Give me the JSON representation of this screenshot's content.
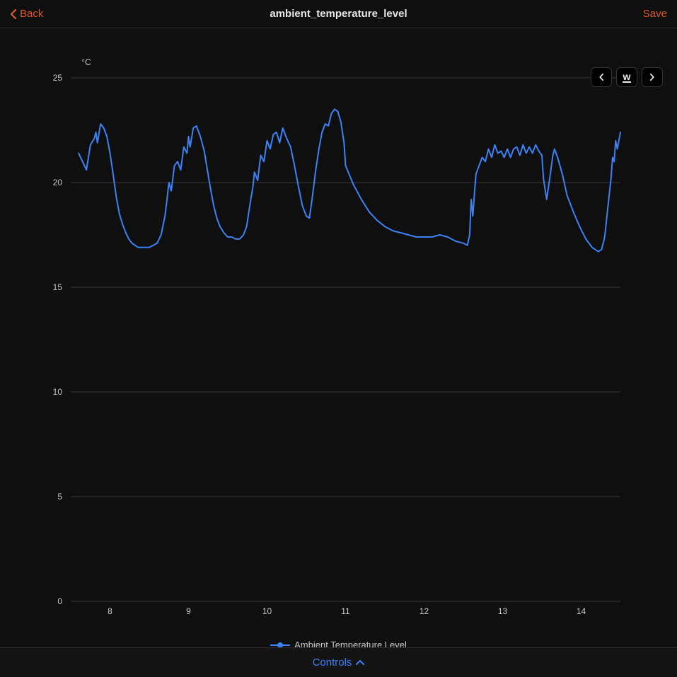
{
  "header": {
    "back_label": "Back",
    "title": "ambient_temperature_level",
    "save_label": "Save"
  },
  "range": {
    "period_label": "w"
  },
  "legend": {
    "series_label": "Ambient Temperature Level"
  },
  "footer": {
    "controls_label": "Controls"
  },
  "colors": {
    "accent": "#e05a1f",
    "series": "#3b82f6",
    "grid": "#3a3a3a",
    "bg": "#0f0f0f"
  },
  "chart_data": {
    "type": "line",
    "title": "ambient_temperature_level",
    "xlabel": "",
    "ylabel": "",
    "unit": "°C",
    "ylim": [
      0,
      25
    ],
    "yticks": [
      0,
      5,
      10,
      15,
      20,
      25
    ],
    "xlim": [
      7.5,
      14.5
    ],
    "xticks": [
      8,
      9,
      10,
      11,
      12,
      13,
      14
    ],
    "legend_position": "bottom",
    "grid": true,
    "series": [
      {
        "name": "Ambient Temperature Level",
        "x": [
          7.6,
          7.65,
          7.7,
          7.75,
          7.8,
          7.82,
          7.84,
          7.88,
          7.92,
          7.96,
          8.0,
          8.04,
          8.08,
          8.12,
          8.16,
          8.2,
          8.24,
          8.28,
          8.32,
          8.36,
          8.4,
          8.45,
          8.5,
          8.55,
          8.6,
          8.65,
          8.7,
          8.72,
          8.75,
          8.78,
          8.82,
          8.86,
          8.9,
          8.94,
          8.98,
          9.0,
          9.02,
          9.06,
          9.1,
          9.15,
          9.2,
          9.24,
          9.28,
          9.32,
          9.36,
          9.4,
          9.45,
          9.5,
          9.55,
          9.6,
          9.65,
          9.7,
          9.74,
          9.78,
          9.82,
          9.84,
          9.88,
          9.92,
          9.96,
          10.0,
          10.04,
          10.08,
          10.12,
          10.16,
          10.2,
          10.25,
          10.3,
          10.35,
          10.4,
          10.45,
          10.5,
          10.54,
          10.58,
          10.62,
          10.66,
          10.7,
          10.74,
          10.78,
          10.82,
          10.86,
          10.9,
          10.94,
          10.98,
          11.0,
          11.1,
          11.2,
          11.3,
          11.4,
          11.5,
          11.6,
          11.7,
          11.8,
          11.9,
          12.0,
          12.1,
          12.2,
          12.3,
          12.4,
          12.5,
          12.55,
          12.58,
          12.6,
          12.62,
          12.66,
          12.7,
          12.74,
          12.78,
          12.82,
          12.86,
          12.9,
          12.94,
          12.98,
          13.02,
          13.06,
          13.1,
          13.14,
          13.18,
          13.22,
          13.26,
          13.3,
          13.34,
          13.38,
          13.42,
          13.46,
          13.5,
          13.52,
          13.56,
          13.6,
          13.64,
          13.66,
          13.7,
          13.76,
          13.82,
          13.9,
          13.98,
          14.06,
          14.14,
          14.22,
          14.26,
          14.3,
          14.34,
          14.38,
          14.4,
          14.42,
          14.44,
          14.46,
          14.5
        ],
        "values": [
          21.4,
          21.0,
          20.6,
          21.8,
          22.1,
          22.4,
          21.9,
          22.8,
          22.6,
          22.2,
          21.4,
          20.4,
          19.3,
          18.5,
          18.0,
          17.6,
          17.3,
          17.1,
          17.0,
          16.9,
          16.9,
          16.9,
          16.9,
          17.0,
          17.1,
          17.5,
          18.4,
          19.0,
          20.0,
          19.6,
          20.8,
          21.0,
          20.6,
          21.7,
          21.4,
          22.2,
          21.7,
          22.6,
          22.7,
          22.2,
          21.5,
          20.6,
          19.7,
          18.9,
          18.3,
          17.9,
          17.6,
          17.4,
          17.4,
          17.3,
          17.3,
          17.5,
          17.9,
          18.9,
          19.8,
          20.5,
          20.1,
          21.3,
          21.0,
          22.0,
          21.6,
          22.3,
          22.4,
          21.9,
          22.6,
          22.1,
          21.7,
          20.8,
          19.8,
          18.9,
          18.4,
          18.3,
          19.4,
          20.6,
          21.6,
          22.4,
          22.8,
          22.7,
          23.3,
          23.5,
          23.4,
          22.9,
          21.9,
          20.8,
          19.9,
          19.2,
          18.6,
          18.2,
          17.9,
          17.7,
          17.6,
          17.5,
          17.4,
          17.4,
          17.4,
          17.5,
          17.4,
          17.2,
          17.1,
          17.0,
          17.5,
          19.2,
          18.4,
          20.4,
          20.8,
          21.2,
          21.0,
          21.6,
          21.2,
          21.8,
          21.4,
          21.5,
          21.2,
          21.6,
          21.2,
          21.6,
          21.7,
          21.3,
          21.8,
          21.4,
          21.7,
          21.4,
          21.8,
          21.5,
          21.3,
          20.2,
          19.2,
          20.2,
          21.3,
          21.6,
          21.2,
          20.4,
          19.4,
          18.6,
          17.9,
          17.3,
          16.9,
          16.7,
          16.8,
          17.4,
          18.8,
          20.2,
          21.2,
          21.0,
          22.0,
          21.6,
          22.4
        ]
      }
    ]
  }
}
